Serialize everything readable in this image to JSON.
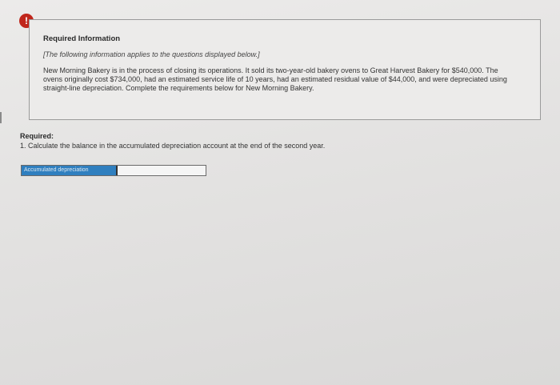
{
  "alert": {
    "icon": "!"
  },
  "info": {
    "title": "Required Information",
    "note": "[The following information applies to the questions displayed below.]",
    "body": "New Morning Bakery is in the process of closing its operations. It sold its two-year-old bakery ovens to Great Harvest Bakery for $540,000. The ovens originally cost $734,000, had an estimated service life of 10 years, had an estimated residual value of $44,000, and were depreciated using straight-line depreciation. Complete the requirements below for New Morning Bakery."
  },
  "required": {
    "heading": "Required:",
    "item1": "1. Calculate the balance in the accumulated depreciation account at the end of the second year."
  },
  "answer": {
    "label": "Accumulated depreciation",
    "value": ""
  }
}
